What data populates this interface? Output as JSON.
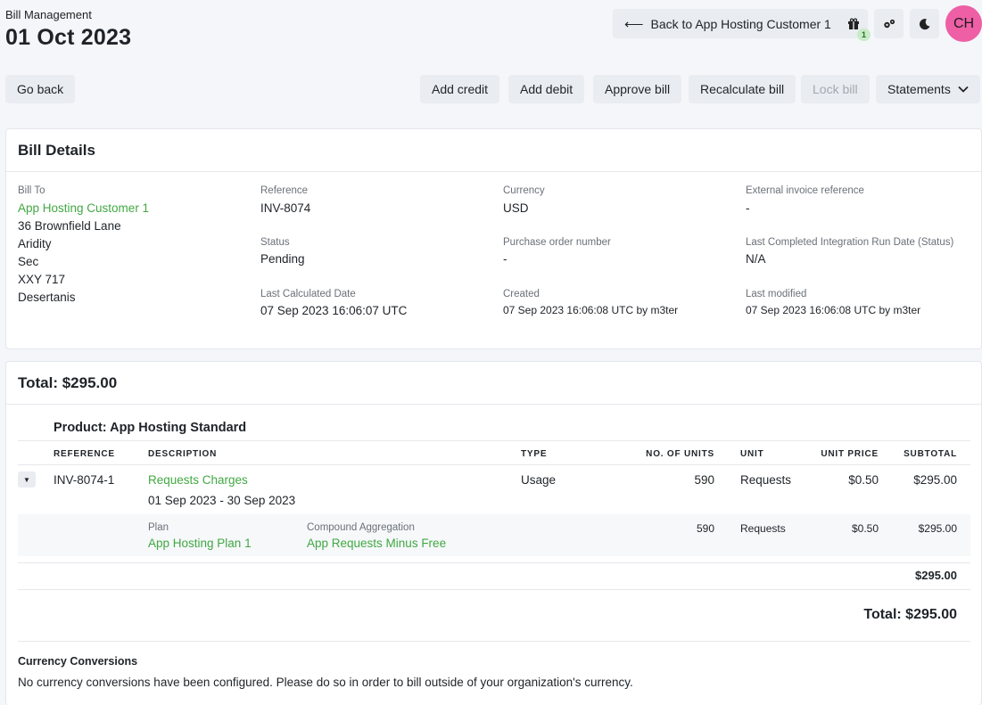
{
  "header": {
    "eyebrow": "Bill Management",
    "title": "01 Oct 2023",
    "back_label": "Back to App Hosting Customer 1",
    "gift_badge": "1",
    "avatar_initials": "CH"
  },
  "toolbar": {
    "go_back": "Go back",
    "add_credit": "Add credit",
    "add_debit": "Add debit",
    "approve_bill": "Approve bill",
    "recalculate_bill": "Recalculate bill",
    "lock_bill": "Lock bill",
    "statements": "Statements"
  },
  "bill_details": {
    "title": "Bill Details",
    "bill_to_label": "Bill To",
    "bill_to_name": "App Hosting Customer 1",
    "address": [
      "36 Brownfield Lane",
      "Aridity",
      "Sec",
      "XXY 717",
      "Desertanis"
    ],
    "reference_label": "Reference",
    "reference": "INV-8074",
    "status_label": "Status",
    "status": "Pending",
    "last_calc_label": "Last Calculated Date",
    "last_calc": "07 Sep 2023 16:06:07 UTC",
    "currency_label": "Currency",
    "currency": "USD",
    "po_label": "Purchase order number",
    "po": "-",
    "created_label": "Created",
    "created": "07 Sep 2023 16:06:08 UTC by m3ter",
    "ext_ref_label": "External invoice reference",
    "ext_ref": "-",
    "integration_label": "Last Completed Integration Run Date (Status)",
    "integration": "N/A",
    "modified_label": "Last modified",
    "modified": "07 Sep 2023 16:06:08 UTC by m3ter"
  },
  "totals": {
    "title": "Total: $295.00",
    "product_title": "Product: App Hosting Standard",
    "columns": {
      "reference": "REFERENCE",
      "description": "DESCRIPTION",
      "type": "TYPE",
      "units": "NO. OF UNITS",
      "unit": "UNIT",
      "unit_price": "UNIT PRICE",
      "subtotal": "SUBTOTAL"
    },
    "line": {
      "reference": "INV-8074-1",
      "description": "Requests Charges",
      "period": "01 Sep 2023 - 30 Sep 2023",
      "type": "Usage",
      "units": "590",
      "unit": "Requests",
      "unit_price": "$0.50",
      "subtotal": "$295.00"
    },
    "detail": {
      "plan_label": "Plan",
      "plan": "App Hosting Plan 1",
      "aggregation_label": "Compound Aggregation",
      "aggregation": "App Requests Minus Free",
      "units": "590",
      "unit": "Requests",
      "unit_price": "$0.50",
      "subtotal": "$295.00"
    },
    "product_subtotal": "$295.00",
    "grand_total": "Total: $295.00",
    "currency_conv_title": "Currency Conversions",
    "currency_conv_text": "No currency conversions have been configured. Please do so in order to bill outside of your organization's currency."
  }
}
